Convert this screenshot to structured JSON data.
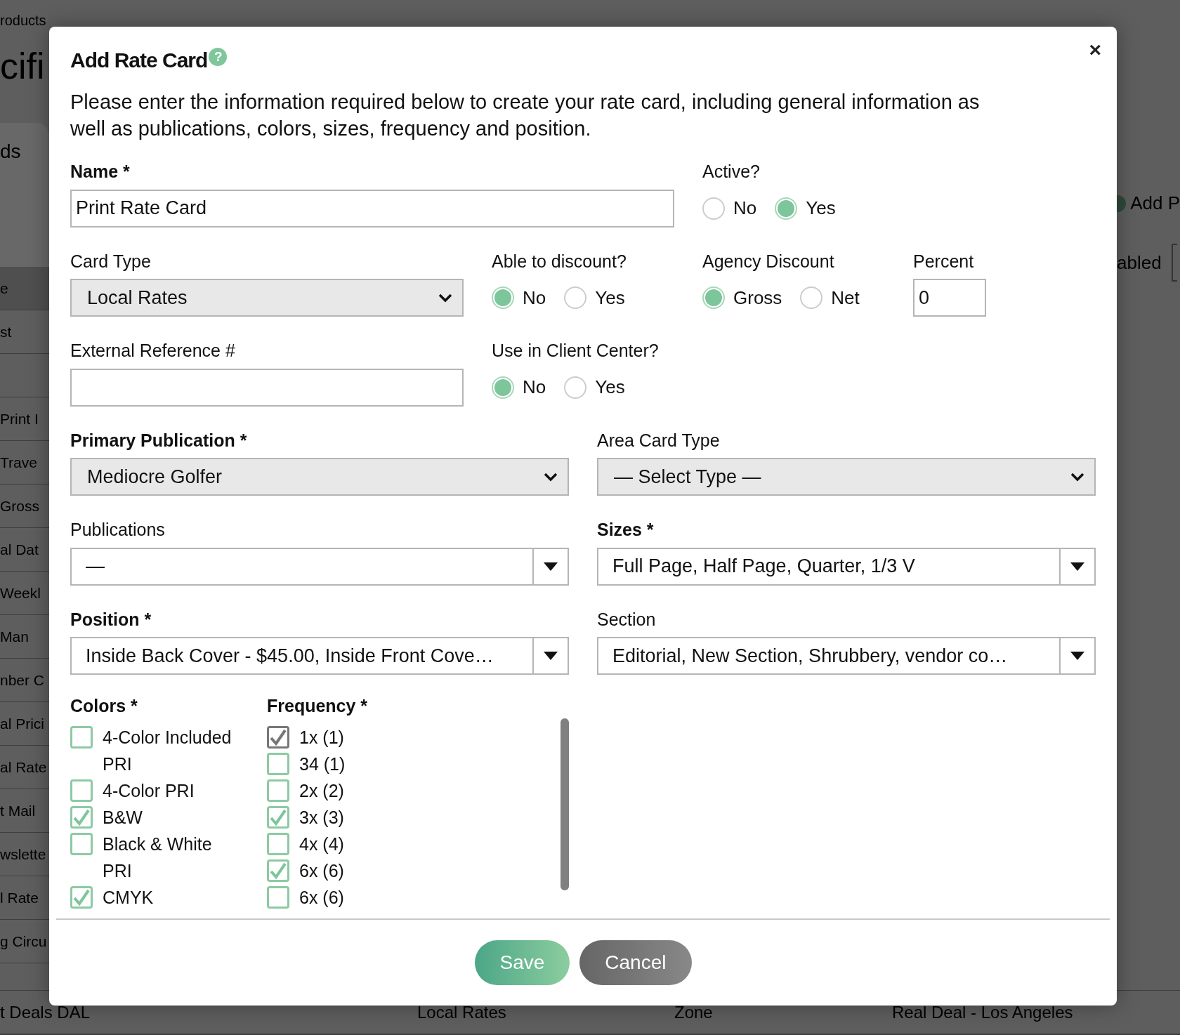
{
  "background": {
    "breadcrumb": "roducts",
    "title": "cifi",
    "tab": "ds",
    "rows": [
      "e",
      "st",
      "Print I",
      "Trave",
      "Gross",
      "al Dat",
      "Weekl",
      "Man",
      "nber C",
      "al Prici",
      "al Rate",
      "t Mail",
      "wslette",
      "l Rate",
      "g Circu"
    ],
    "bottom_row": [
      "t Deals DAL",
      "Local Rates",
      "Zone",
      "Real Deal - Los Angeles"
    ],
    "add_button": "Add P",
    "right_label": "abled"
  },
  "dialog": {
    "title": "Add Rate Card",
    "help": "?",
    "close": "×",
    "description": "Please enter the information required below to create your rate card, including general information as well as publications, colors, sizes, frequency and position.",
    "name": {
      "label": "Name *",
      "required": true,
      "value": "Print Rate Card"
    },
    "active": {
      "label": "Active?",
      "required": false,
      "options": [
        {
          "label": "No",
          "selected": false
        },
        {
          "label": "Yes",
          "selected": true
        }
      ]
    },
    "card_type": {
      "label": "Card Type",
      "required": false,
      "value": "Local Rates"
    },
    "able_to_discount": {
      "label": "Able to discount?",
      "required": false,
      "options": [
        {
          "label": "No",
          "selected": true
        },
        {
          "label": "Yes",
          "selected": false
        }
      ]
    },
    "agency_discount": {
      "label": "Agency Discount",
      "required": false,
      "options": [
        {
          "label": "Gross",
          "selected": true
        },
        {
          "label": "Net",
          "selected": false
        }
      ]
    },
    "percent": {
      "label": "Percent",
      "required": false,
      "value": "0"
    },
    "external_reference": {
      "label": "External Reference #",
      "required": false
    },
    "use_in_client_center": {
      "label": "Use in Client Center?",
      "required": false,
      "options": [
        {
          "label": "No",
          "selected": true
        },
        {
          "label": "Yes",
          "selected": false
        }
      ]
    },
    "primary_publication": {
      "label": "Primary Publication *",
      "required": true,
      "value": "Mediocre Golfer"
    },
    "area_card_type": {
      "label": "Area Card Type",
      "required": false,
      "value": "— Select Type —"
    },
    "publications": {
      "label": "Publications",
      "required": false,
      "value": "—"
    },
    "sizes": {
      "label": "Sizes *",
      "required": true,
      "value": "Full Page, Half Page, Quarter, 1/3 V"
    },
    "position": {
      "label": "Position *",
      "required": true,
      "value": "Inside Back Cover - $45.00, Inside Front Cove…"
    },
    "section": {
      "label": "Section",
      "required": false,
      "value": "Editorial, New Section, Shrubbery, vendor co…"
    },
    "colors": {
      "label": "Colors *",
      "required": true,
      "items": [
        {
          "label": "4-Color Included PRI",
          "checked": false,
          "disabled": false
        },
        {
          "label": "4-Color PRI",
          "checked": false,
          "disabled": false
        },
        {
          "label": "B&W",
          "checked": true,
          "disabled": false
        },
        {
          "label": "Black & White PRI",
          "checked": false,
          "disabled": false
        },
        {
          "label": "CMYK",
          "checked": true,
          "disabled": false
        }
      ]
    },
    "frequency": {
      "label": "Frequency *",
      "required": true,
      "items": [
        {
          "label": "1x (1)",
          "checked": true,
          "disabled": true
        },
        {
          "label": "34 (1)",
          "checked": false,
          "disabled": false
        },
        {
          "label": "2x (2)",
          "checked": false,
          "disabled": false
        },
        {
          "label": "3x (3)",
          "checked": true,
          "disabled": false
        },
        {
          "label": "4x (4)",
          "checked": false,
          "disabled": false
        },
        {
          "label": "6x (6)",
          "checked": true,
          "disabled": false
        },
        {
          "label": "6x (6)",
          "checked": false,
          "disabled": false
        }
      ]
    },
    "buttons": [
      {
        "label": "Save",
        "kind": "primary"
      },
      {
        "label": "Cancel",
        "kind": "secondary"
      }
    ]
  }
}
